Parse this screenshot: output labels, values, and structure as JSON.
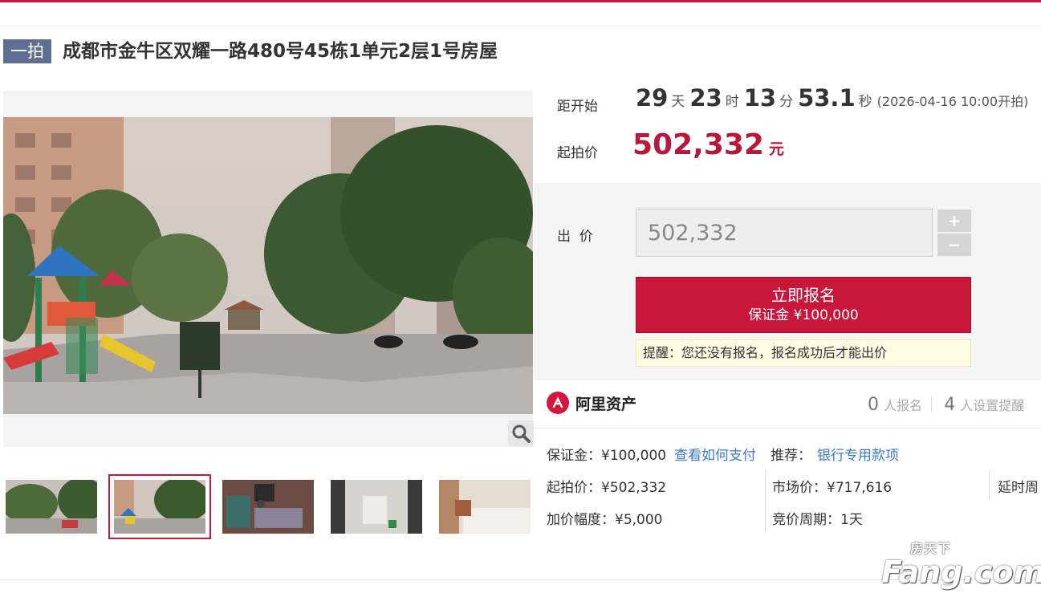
{
  "header": {
    "badge": "一拍",
    "title": "成都市金牛区双耀一路480号45栋1单元2层1号房屋"
  },
  "countdown": {
    "label": "距开始",
    "days": "29",
    "days_unit": "天",
    "hours": "23",
    "hours_unit": "时",
    "minutes": "13",
    "minutes_unit": "分",
    "seconds": "53.1",
    "seconds_unit": "秒",
    "start_time": "(2026-04-16 10:00开拍)"
  },
  "start_price": {
    "label": "起拍价",
    "value": "502,332",
    "unit": "元"
  },
  "bid": {
    "label": "出  价",
    "input_value": "502,332",
    "plus": "+",
    "minus": "−",
    "apply_label": "立即报名",
    "deposit_label": "保证金 ¥100,000",
    "notice": "提醒：您还没有报名，报名成功后才能出价"
  },
  "platform": {
    "name": "阿里资产",
    "signups_num": "0",
    "signups_txt": "人报名",
    "reminders_num": "4",
    "reminders_txt": "人设置提醒"
  },
  "details": {
    "deposit": "保证金：¥100,000",
    "how_to_pay": "查看如何支付",
    "recommend_label": "推荐：",
    "recommend_link": "银行专用款项",
    "start_price": "起拍价：¥502,332",
    "market_price": "市场价：¥717,616",
    "delay": "延时周",
    "increment": "加价幅度：¥5,000",
    "cycle": "竞价周期：1天"
  },
  "watermark": {
    "top": "房天下",
    "main": "Fang.com"
  },
  "colors": {
    "accent": "#c8173b",
    "badge": "#5f6f93",
    "link": "#3a7bc8"
  },
  "icons": {
    "zoom": "magnifier-icon",
    "platform": "ali-asset-logo-icon"
  }
}
